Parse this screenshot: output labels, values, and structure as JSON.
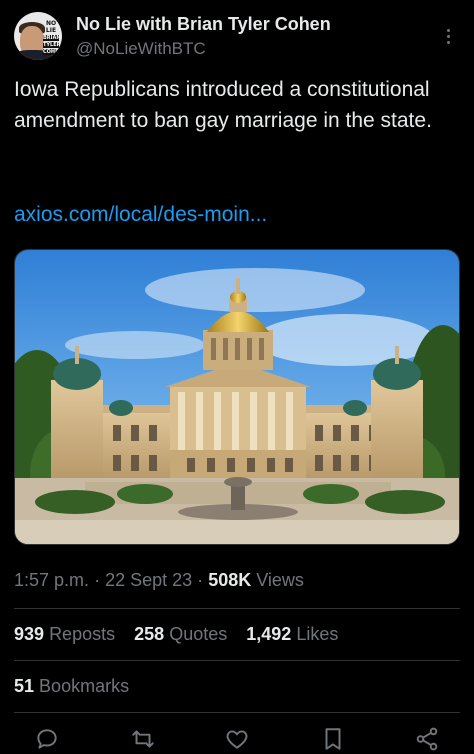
{
  "post": {
    "author_name": "No Lie with Brian Tyler Cohen",
    "author_handle": "@NoLieWithBTC",
    "avatar_logo": [
      "NO LIE",
      "BRIAN",
      "TYLER",
      "COHEN"
    ],
    "text": "Iowa Republicans introduced a constitutional amendment to ban gay marriage in the state.",
    "link": "axios.com/local/des-moin...",
    "time": "1:57 p.m.",
    "sep": "·",
    "date": "22 Sept 23",
    "views_count": "508K",
    "views_label": "Views"
  },
  "stats": {
    "reposts_count": "939",
    "reposts_label": "Reposts",
    "quotes_count": "258",
    "quotes_label": "Quotes",
    "likes_count": "1,492",
    "likes_label": "Likes",
    "bookmarks_count": "51",
    "bookmarks_label": "Bookmarks"
  },
  "colors": {
    "background": "#000000",
    "text": "#e7e9ea",
    "muted": "#71767b",
    "link": "#1d9bf0",
    "divider": "#2f3336"
  },
  "icons": [
    "more-icon",
    "reply-icon",
    "repost-icon",
    "like-icon",
    "bookmark-icon",
    "share-icon"
  ]
}
